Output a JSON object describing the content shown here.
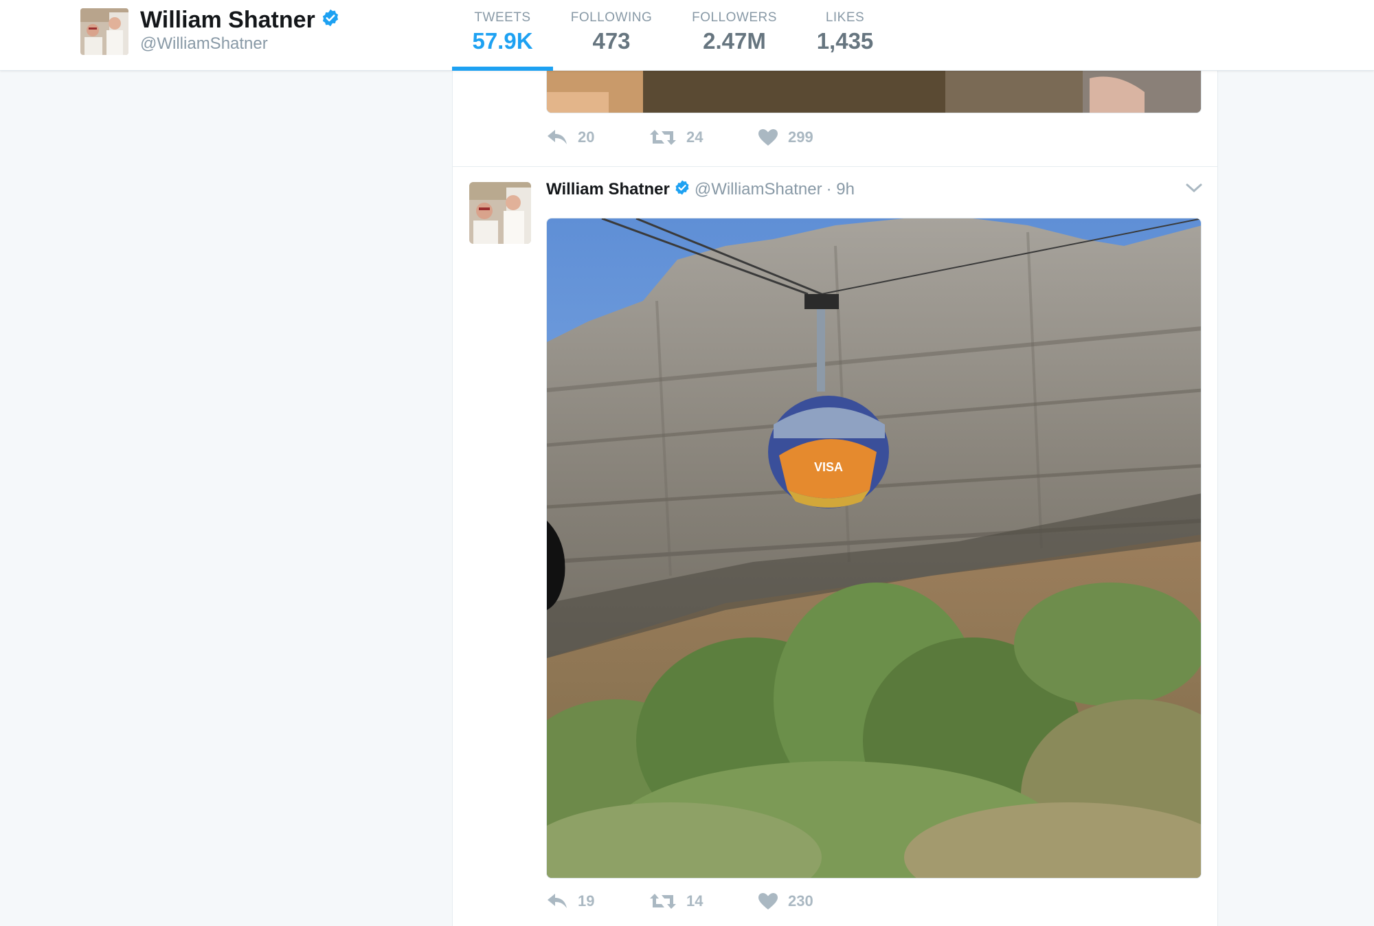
{
  "profile": {
    "name": "William Shatner",
    "handle": "@WilliamShatner"
  },
  "stats": [
    {
      "label": "TWEETS",
      "value": "57.9K",
      "active": true
    },
    {
      "label": "FOLLOWING",
      "value": "473",
      "active": false
    },
    {
      "label": "FOLLOWERS",
      "value": "2.47M",
      "active": false
    },
    {
      "label": "LIKES",
      "value": "1,435",
      "active": false
    }
  ],
  "previous_tweet": {
    "replies": "20",
    "retweets": "24",
    "likes": "299"
  },
  "tweet": {
    "name": "William Shatner",
    "handle": "@WilliamShatner",
    "time": "· 9h",
    "cable_car_text": "VISA",
    "replies": "19",
    "retweets": "14",
    "likes": "230"
  },
  "colors": {
    "accent": "#1da1f2",
    "muted": "#8899a6",
    "action_gray": "#aab8c2",
    "verified": "#1da1f2"
  },
  "icons": [
    "verified-badge-icon",
    "reply-icon",
    "retweet-icon",
    "heart-icon",
    "chevron-down-icon"
  ]
}
